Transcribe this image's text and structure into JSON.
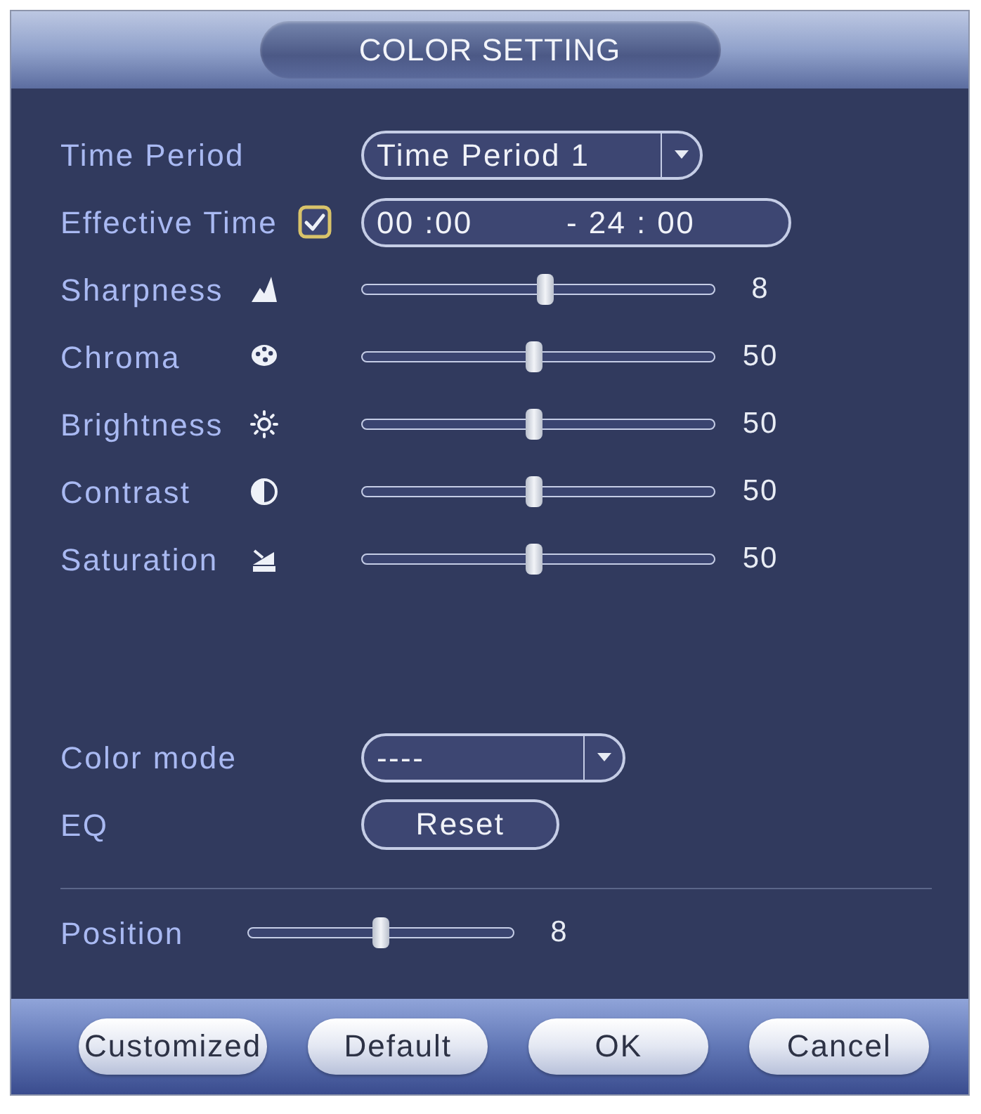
{
  "dialog": {
    "title": "COLOR SETTING"
  },
  "time_period": {
    "label": "Time Period",
    "value": "Time Period 1"
  },
  "effective_time": {
    "label": "Effective Time",
    "checked": true,
    "start": "00 :00",
    "end": "- 24 : 00"
  },
  "sliders": [
    {
      "label": "Sharpness",
      "level": 0.52,
      "reading": "8"
    },
    {
      "label": "Chroma",
      "level": 0.49,
      "reading": "50"
    },
    {
      "label": "Brightness",
      "level": 0.49,
      "reading": "50"
    },
    {
      "label": "Contrast",
      "level": 0.49,
      "reading": "50"
    },
    {
      "label": "Saturation",
      "level": 0.49,
      "reading": "50"
    }
  ],
  "color_mode": {
    "label": "Color mode",
    "value": "----"
  },
  "eq": {
    "label": "EQ",
    "button": "Reset"
  },
  "position": {
    "label": "Position",
    "level": 0.5,
    "reading": "8"
  },
  "buttons": [
    "Customized",
    "Default",
    "OK",
    "Cancel"
  ]
}
